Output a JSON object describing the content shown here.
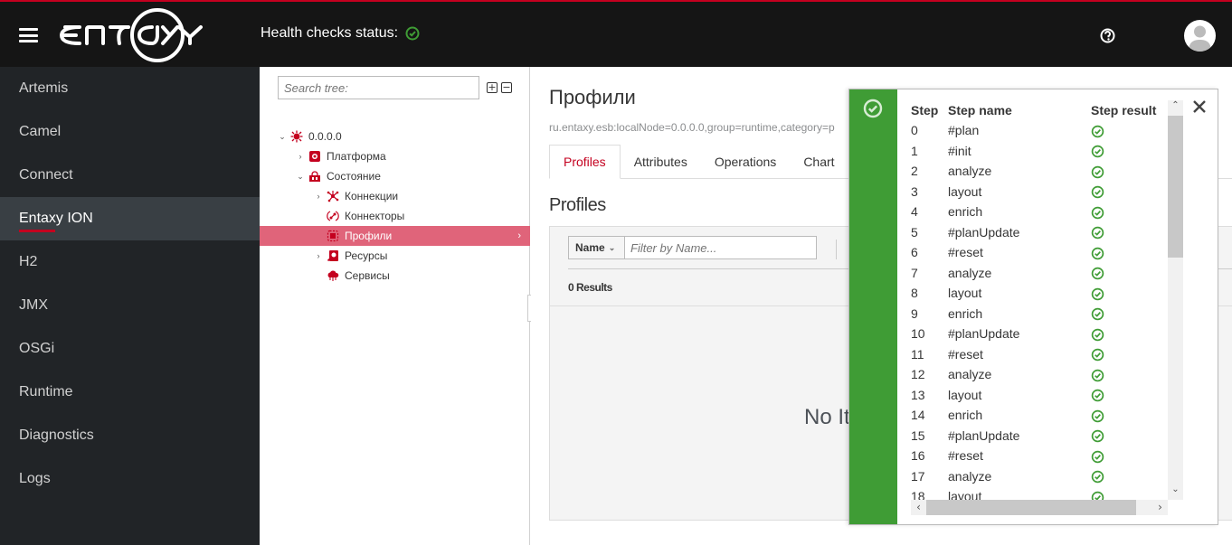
{
  "header": {
    "logo_text": "entaxy",
    "health_label": "Health checks status:",
    "health_status": "ok",
    "colors": {
      "accent": "#c4001f",
      "background": "#151515",
      "ok": "#3f9c35"
    }
  },
  "sidebar": {
    "items": [
      {
        "label": "Artemis",
        "active": false
      },
      {
        "label": "Camel",
        "active": false
      },
      {
        "label": "Connect",
        "active": false
      },
      {
        "label": "Entaxy ION",
        "active": true
      },
      {
        "label": "H2",
        "active": false
      },
      {
        "label": "JMX",
        "active": false
      },
      {
        "label": "OSGi",
        "active": false
      },
      {
        "label": "Runtime",
        "active": false
      },
      {
        "label": "Diagnostics",
        "active": false
      },
      {
        "label": "Logs",
        "active": false
      }
    ]
  },
  "tree": {
    "search_placeholder": "Search tree:",
    "expand_all": "⊞",
    "collapse_all": "⊟",
    "nodes": [
      {
        "label": "0.0.0.0",
        "level": 0,
        "expander": "open",
        "icon": "node-icon"
      },
      {
        "label": "Платформа",
        "level": 1,
        "expander": "closed",
        "icon": "platform-icon"
      },
      {
        "label": "Состояние",
        "level": 1,
        "expander": "open",
        "icon": "state-icon"
      },
      {
        "label": "Коннекции",
        "level": 2,
        "expander": "closed",
        "icon": "connections-icon"
      },
      {
        "label": "Коннекторы",
        "level": 2,
        "expander": "none",
        "icon": "connectors-icon"
      },
      {
        "label": "Профили",
        "level": 2,
        "expander": "none",
        "icon": "profiles-icon",
        "selected": true
      },
      {
        "label": "Ресурсы",
        "level": 2,
        "expander": "closed",
        "icon": "resources-icon"
      },
      {
        "label": "Сервисы",
        "level": 2,
        "expander": "none",
        "icon": "services-icon"
      }
    ]
  },
  "main": {
    "title": "Профили",
    "mbean": "ru.entaxy.esb:localNode=0.0.0.0,group=runtime,category=p",
    "tabs": [
      {
        "label": "Profiles",
        "active": true
      },
      {
        "label": "Attributes",
        "active": false
      },
      {
        "label": "Operations",
        "active": false
      },
      {
        "label": "Chart",
        "active": false
      }
    ],
    "section_title": "Profiles",
    "filter": {
      "field": "Name",
      "placeholder": "Filter by Name...",
      "value": ""
    },
    "results": "0 Results",
    "empty_text": "No Items"
  },
  "toast": {
    "type": "success",
    "columns": [
      "Step",
      "Step name",
      "Step result"
    ],
    "rows": [
      {
        "step": "0",
        "name": "#plan",
        "result": "success"
      },
      {
        "step": "1",
        "name": "#init",
        "result": "success"
      },
      {
        "step": "2",
        "name": "analyze",
        "result": "success"
      },
      {
        "step": "3",
        "name": "layout",
        "result": "success"
      },
      {
        "step": "4",
        "name": "enrich",
        "result": "success"
      },
      {
        "step": "5",
        "name": "#planUpdate",
        "result": "success"
      },
      {
        "step": "6",
        "name": "#reset",
        "result": "success"
      },
      {
        "step": "7",
        "name": "analyze",
        "result": "success"
      },
      {
        "step": "8",
        "name": "layout",
        "result": "success"
      },
      {
        "step": "9",
        "name": "enrich",
        "result": "success"
      },
      {
        "step": "10",
        "name": "#planUpdate",
        "result": "success"
      },
      {
        "step": "11",
        "name": "#reset",
        "result": "success"
      },
      {
        "step": "12",
        "name": "analyze",
        "result": "success"
      },
      {
        "step": "13",
        "name": "layout",
        "result": "success"
      },
      {
        "step": "14",
        "name": "enrich",
        "result": "success"
      },
      {
        "step": "15",
        "name": "#planUpdate",
        "result": "success"
      },
      {
        "step": "16",
        "name": "#reset",
        "result": "success"
      },
      {
        "step": "17",
        "name": "analyze",
        "result": "success"
      },
      {
        "step": "18",
        "name": "layout",
        "result": "success"
      }
    ]
  }
}
